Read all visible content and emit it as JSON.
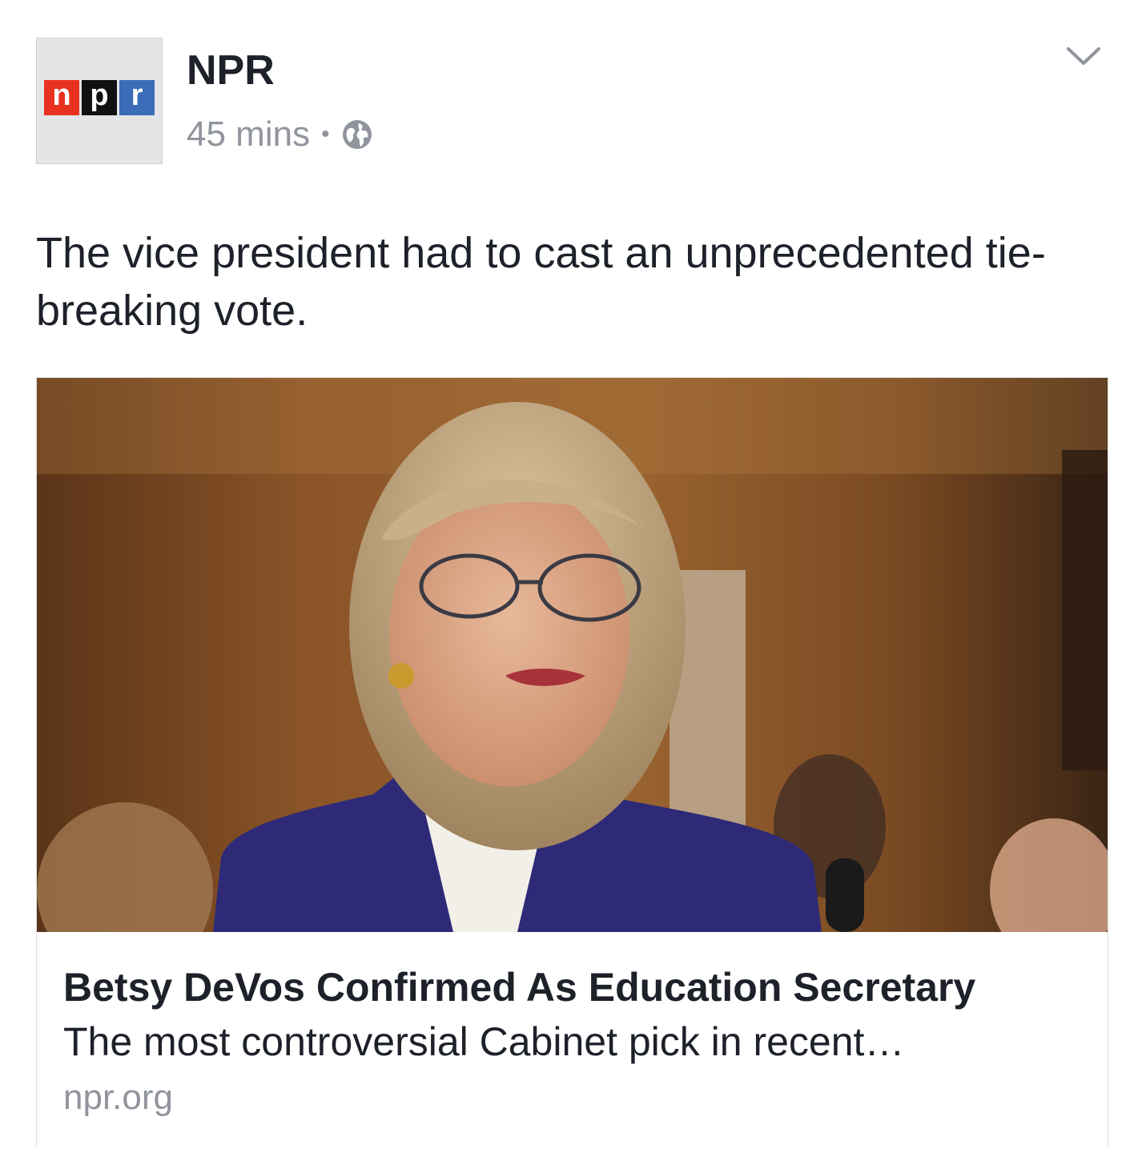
{
  "post": {
    "page_name": "NPR",
    "timestamp": "45 mins",
    "separator": "•",
    "privacy_icon": "globe-icon",
    "menu_icon": "chevron-down-icon",
    "message": "The vice president had to cast an unprecedented tie-breaking vote."
  },
  "avatar": {
    "logo_letters": [
      "n",
      "p",
      "r"
    ],
    "logo_colors": [
      "#e8321f",
      "#111111",
      "#3b6cb7"
    ]
  },
  "link_preview": {
    "image_description_icon": "photo",
    "title": "Betsy DeVos Confirmed As Education Secretary",
    "description": "The most controversial Cabinet pick in recent…",
    "domain": "npr.org"
  },
  "colors": {
    "text_primary": "#1d2129",
    "text_secondary": "#90949c",
    "border": "#dddfe2"
  }
}
